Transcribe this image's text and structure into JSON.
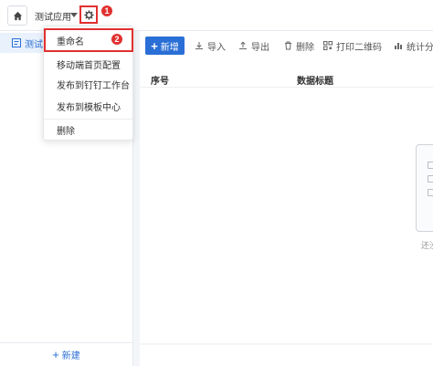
{
  "header": {
    "app_title": "测试应用"
  },
  "sidebar": {
    "items": [
      {
        "label": "测试"
      }
    ],
    "footer_label": "新建"
  },
  "toolbar": {
    "new_label": "新增",
    "import_label": "导入",
    "export_label": "导出",
    "delete_label": "删除",
    "print_qr_label": "打印二维码",
    "stats_label": "统计分析"
  },
  "table": {
    "columns": [
      "序号",
      "数据标题"
    ]
  },
  "empty_state": {
    "text": "还没"
  },
  "menu": {
    "items": [
      "重命名",
      "移动端首页配置",
      "发布到钉钉工作台",
      "发布到模板中心",
      "删除"
    ]
  },
  "annotations": {
    "badge1": "1",
    "badge2": "2"
  },
  "colors": {
    "accent": "#2a6fd6",
    "highlight": "#e0312f"
  }
}
